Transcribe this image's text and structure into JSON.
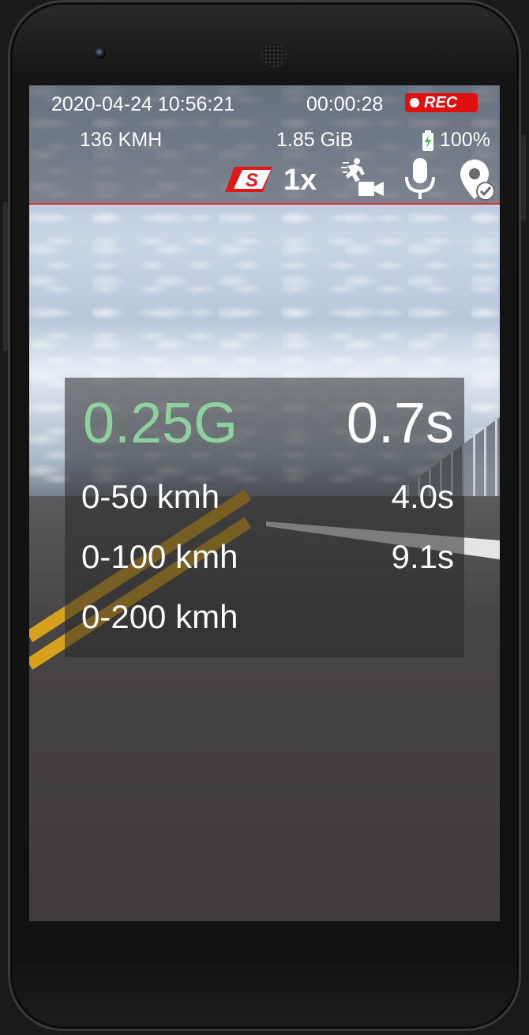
{
  "status": {
    "datetime": "2020-04-24 10:56:21",
    "elapsed": "00:00:28",
    "rec_label": "REC",
    "speed": "136 KMH",
    "storage": "1.85 GiB",
    "battery": "100%"
  },
  "controls": {
    "zoom": "1x",
    "logo_letter": "S",
    "icons": [
      "sport-s-icon",
      "motion-camera-icon",
      "microphone-icon",
      "location-check-icon"
    ]
  },
  "panel": {
    "g_force": "0.25G",
    "current_time": "0.7s",
    "rows": [
      {
        "label": "0-50 kmh",
        "value": "4.0s"
      },
      {
        "label": "0-100 kmh",
        "value": "9.1s"
      },
      {
        "label": "0-200 kmh",
        "value": ""
      }
    ]
  },
  "colors": {
    "rec": "#e01010",
    "g_force": "#8fd19e",
    "accent_line": "#d63030",
    "battery": "#3fc04a"
  }
}
